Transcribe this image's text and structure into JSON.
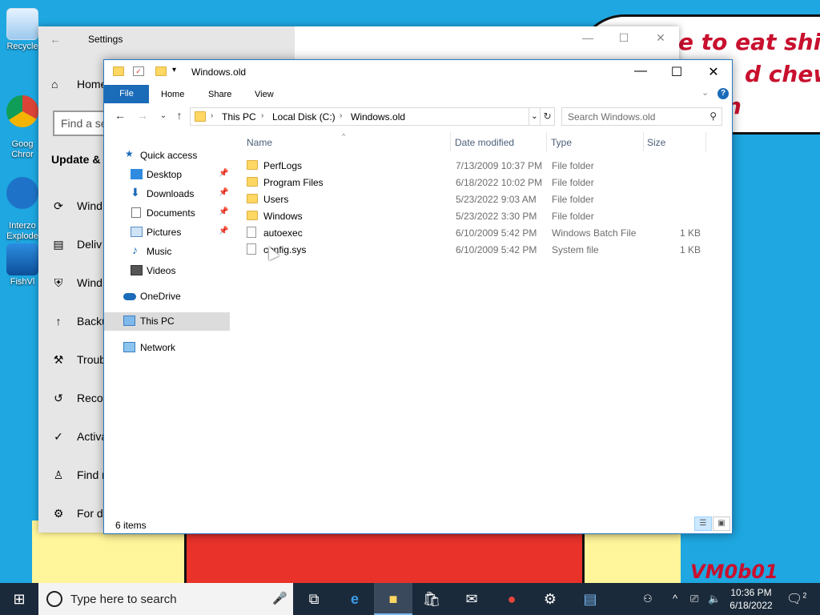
{
  "desktop": {
    "wallpaper_lines": [
      "e to eat shit",
      "d chew",
      "n"
    ],
    "signature": "VM0b01",
    "icons": [
      {
        "name": "recycle-bin",
        "label": "Recycle"
      },
      {
        "name": "google-chrome",
        "label": "Goog\nChror"
      },
      {
        "name": "internet-explorer",
        "label": "Interzo\nExplode"
      },
      {
        "name": "fishvm",
        "label": "FishVl"
      }
    ]
  },
  "settings": {
    "title": "Settings",
    "home_label": "Home",
    "search_placeholder": "Find a se",
    "section_title": "Update &",
    "items": [
      {
        "icon": "sync-icon",
        "label": "Wind"
      },
      {
        "icon": "delivery-icon",
        "label": "Deliv"
      },
      {
        "icon": "shield-icon",
        "label": "Wind"
      },
      {
        "icon": "backup-icon",
        "label": "Backu"
      },
      {
        "icon": "wrench-icon",
        "label": "Troub"
      },
      {
        "icon": "recovery-icon",
        "label": "Recov"
      },
      {
        "icon": "activation-icon",
        "label": "Activa"
      },
      {
        "icon": "person-icon",
        "label": "Find m"
      },
      {
        "icon": "developer-icon",
        "label": "For de"
      }
    ]
  },
  "explorer": {
    "title": "Windows.old",
    "ribbon_tabs": {
      "file": "File",
      "home": "Home",
      "share": "Share",
      "view": "View"
    },
    "breadcrumb": [
      "This PC",
      "Local Disk (C:)",
      "Windows.old"
    ],
    "search_placeholder": "Search Windows.old",
    "nav": {
      "quick_access": "Quick access",
      "desktop": "Desktop",
      "downloads": "Downloads",
      "documents": "Documents",
      "pictures": "Pictures",
      "music": "Music",
      "videos": "Videos",
      "onedrive": "OneDrive",
      "this_pc": "This PC",
      "network": "Network"
    },
    "columns": {
      "name": "Name",
      "date": "Date modified",
      "type": "Type",
      "size": "Size"
    },
    "files": [
      {
        "name": "PerfLogs",
        "date": "7/13/2009 10:37 PM",
        "type": "File folder",
        "size": ""
      },
      {
        "name": "Program Files",
        "date": "6/18/2022 10:02 PM",
        "type": "File folder",
        "size": ""
      },
      {
        "name": "Users",
        "date": "5/23/2022 9:03 AM",
        "type": "File folder",
        "size": ""
      },
      {
        "name": "Windows",
        "date": "5/23/2022 3:30 PM",
        "type": "File folder",
        "size": ""
      },
      {
        "name": "autoexec",
        "date": "6/10/2009 5:42 PM",
        "type": "Windows Batch File",
        "size": "1 KB"
      },
      {
        "name": "config.sys",
        "date": "6/10/2009 5:42 PM",
        "type": "System file",
        "size": "1 KB"
      }
    ],
    "status": "6 items"
  },
  "taskbar": {
    "search_placeholder": "Type here to search",
    "time": "10:36 PM",
    "date": "6/18/2022",
    "notifications": "2"
  },
  "colors": {
    "desktop": "#1ea7e1",
    "accent": "#1a6bb8",
    "taskbar": "#1b2a3a",
    "folder": "#ffd763"
  }
}
